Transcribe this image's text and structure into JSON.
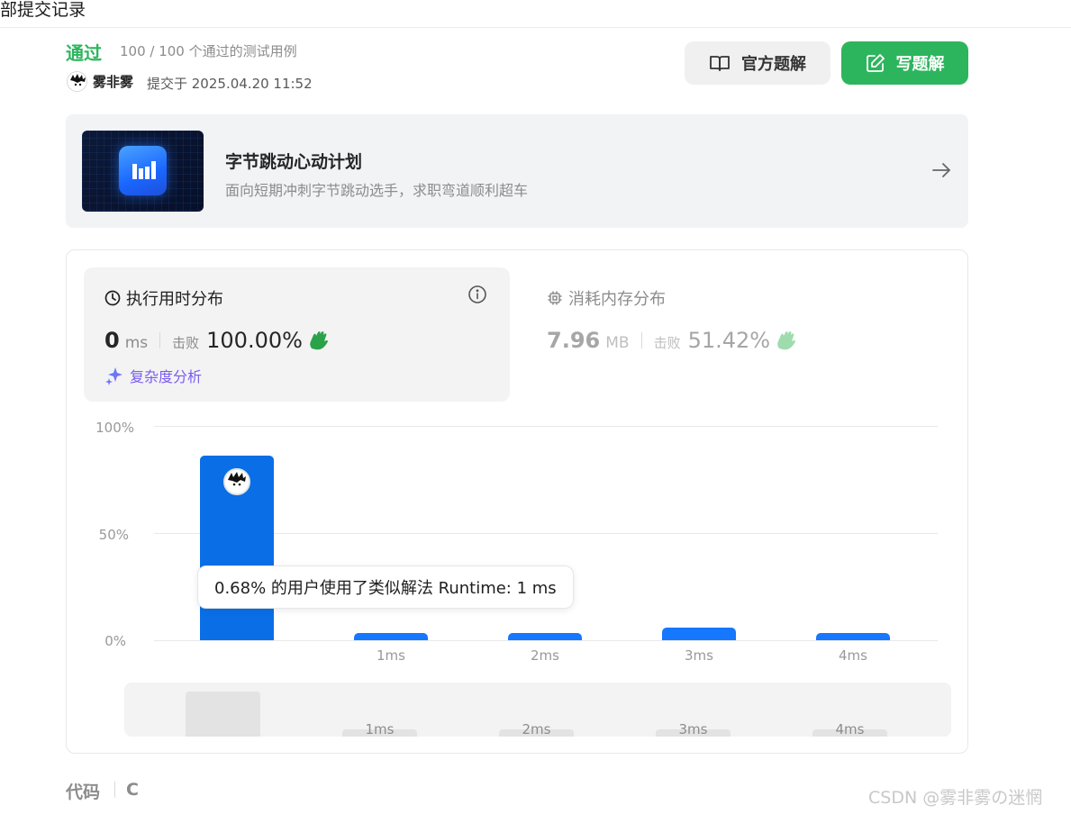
{
  "header": {
    "title": "部提交记录"
  },
  "submission": {
    "status": "通过",
    "cases": "100 / 100 个通过的测试用例",
    "username": "雾非雾",
    "submitted_at": "提交于 2025.04.20 11:52"
  },
  "actions": {
    "official_label": "官方题解",
    "official_icon": "book-icon",
    "write_label": "写题解",
    "write_icon": "edit-icon"
  },
  "banner": {
    "title": "字节跳动心动计划",
    "subtitle": "面向短期冲刺字节跳动选手，求职弯道顺利超车",
    "icon": "arrow-right-icon"
  },
  "runtime": {
    "title": "执行用时分布",
    "value": "0",
    "unit": "ms",
    "beat_label": "击败",
    "beat_pct": "100.00%",
    "complexity_label": "复杂度分析"
  },
  "memory": {
    "title": "消耗内存分布",
    "value": "7.96",
    "unit": "MB",
    "beat_label": "击败",
    "beat_pct": "51.42%"
  },
  "tooltip": "0.68% 的用户使用了类似解法 Runtime: 1 ms",
  "colors": {
    "accent_green": "#2db55d",
    "bar_blue": "#0a6fe6",
    "purple": "#7b5cf0"
  },
  "chart_data": {
    "type": "bar",
    "categories": [
      "",
      "1ms",
      "2ms",
      "3ms",
      "4ms"
    ],
    "values": [
      86,
      3,
      3,
      6,
      3
    ],
    "yticks": [
      "100%",
      "50%",
      "0%"
    ],
    "ylim": [
      0,
      100
    ],
    "minimap_labels": [
      "1ms",
      "2ms",
      "3ms",
      "4ms"
    ]
  },
  "code": {
    "label": "代码",
    "language": "C"
  },
  "watermark": "CSDN @雾非雾の迷惘"
}
